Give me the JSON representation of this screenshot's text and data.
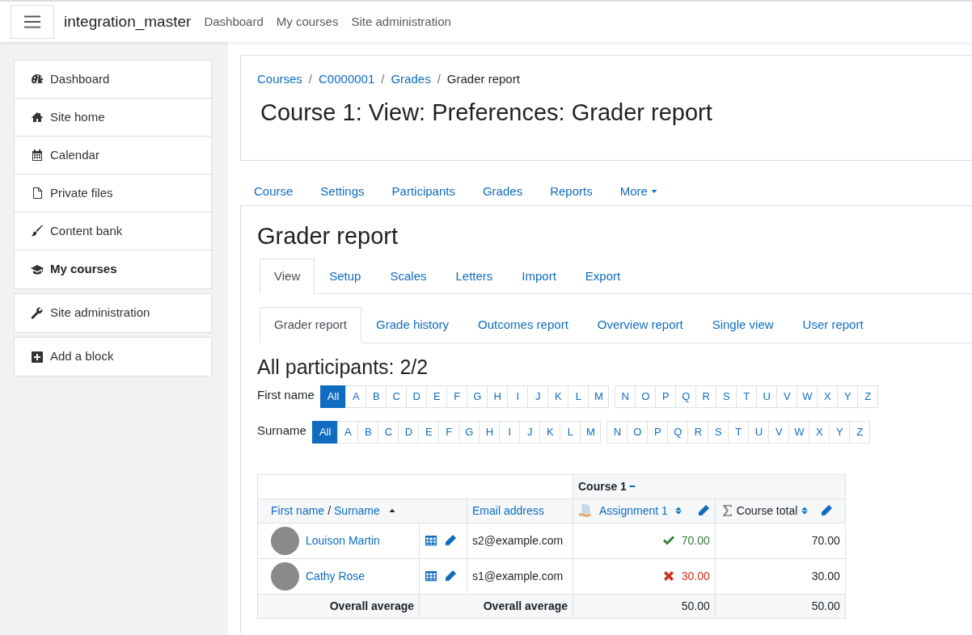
{
  "navbar": {
    "brand": "integration_master",
    "links": [
      "Dashboard",
      "My courses",
      "Site administration"
    ]
  },
  "sidebar": {
    "groups": [
      {
        "items": [
          {
            "label": "Dashboard",
            "kind": "gauge",
            "selected": false
          },
          {
            "label": "Site home",
            "kind": "home",
            "selected": false
          },
          {
            "label": "Calendar",
            "kind": "calendar",
            "selected": false
          },
          {
            "label": "Private files",
            "kind": "file",
            "selected": false
          },
          {
            "label": "Content bank",
            "kind": "brush",
            "selected": false
          },
          {
            "label": "My courses",
            "kind": "cap",
            "selected": true
          }
        ]
      },
      {
        "items": [
          {
            "label": "Site administration",
            "kind": "wrench",
            "selected": false
          }
        ]
      },
      {
        "items": [
          {
            "label": "Add a block",
            "kind": "plus",
            "selected": false
          }
        ]
      }
    ]
  },
  "breadcrumb": [
    {
      "kind": "link",
      "text": "Courses"
    },
    {
      "kind": "separator",
      "text": "/"
    },
    {
      "kind": "link",
      "text": "C0000001"
    },
    {
      "kind": "separator",
      "text": "/"
    },
    {
      "kind": "link",
      "text": "Grades"
    },
    {
      "kind": "separator",
      "text": "/"
    },
    {
      "kind": "current",
      "text": "Grader report"
    }
  ],
  "page_title": "Course 1: View: Preferences: Grader report",
  "course_nav": [
    {
      "label": "Course",
      "dropdown": false
    },
    {
      "label": "Settings",
      "dropdown": false
    },
    {
      "label": "Participants",
      "dropdown": false
    },
    {
      "label": "Grades",
      "dropdown": false
    },
    {
      "label": "Reports",
      "dropdown": false
    },
    {
      "label": "More",
      "dropdown": true
    }
  ],
  "report_title": "Grader report",
  "tabs": [
    {
      "label": "View",
      "selected": true
    },
    {
      "label": "Setup",
      "selected": false
    },
    {
      "label": "Scales",
      "selected": false
    },
    {
      "label": "Letters",
      "selected": false
    },
    {
      "label": "Import",
      "selected": false
    },
    {
      "label": "Export",
      "selected": false
    }
  ],
  "subtabs": [
    {
      "label": "Grader report",
      "selected": true
    },
    {
      "label": "Grade history",
      "selected": false
    },
    {
      "label": "Outcomes report",
      "selected": false
    },
    {
      "label": "Overview report",
      "selected": false
    },
    {
      "label": "Single view",
      "selected": false
    },
    {
      "label": "User report",
      "selected": false
    }
  ],
  "participants_heading": "All participants: 2/2",
  "initials_bars": [
    {
      "label": "First name",
      "all": {
        "text": "All",
        "selected": true
      },
      "groups": [
        [
          {
            "text": "A",
            "selected": false
          },
          {
            "text": "B",
            "selected": false
          },
          {
            "text": "C",
            "selected": false
          },
          {
            "text": "D",
            "selected": false
          },
          {
            "text": "E",
            "selected": false
          },
          {
            "text": "F",
            "selected": false
          },
          {
            "text": "G",
            "selected": false
          },
          {
            "text": "H",
            "selected": false
          },
          {
            "text": "I",
            "selected": false
          },
          {
            "text": "J",
            "selected": false
          },
          {
            "text": "K",
            "selected": false
          },
          {
            "text": "L",
            "selected": false
          },
          {
            "text": "M",
            "selected": false
          }
        ],
        [
          {
            "text": "N",
            "selected": false
          },
          {
            "text": "O",
            "selected": false
          },
          {
            "text": "P",
            "selected": false
          },
          {
            "text": "Q",
            "selected": false
          },
          {
            "text": "R",
            "selected": false
          },
          {
            "text": "S",
            "selected": false
          },
          {
            "text": "T",
            "selected": false
          },
          {
            "text": "U",
            "selected": false
          },
          {
            "text": "V",
            "selected": false
          },
          {
            "text": "W",
            "selected": false
          },
          {
            "text": "X",
            "selected": false
          },
          {
            "text": "Y",
            "selected": false
          },
          {
            "text": "Z",
            "selected": false
          }
        ]
      ]
    },
    {
      "label": "Surname",
      "all": {
        "text": "All",
        "selected": true
      },
      "groups": [
        [
          {
            "text": "A",
            "selected": false
          },
          {
            "text": "B",
            "selected": false
          },
          {
            "text": "C",
            "selected": false
          },
          {
            "text": "D",
            "selected": false
          },
          {
            "text": "E",
            "selected": false
          },
          {
            "text": "F",
            "selected": false
          },
          {
            "text": "G",
            "selected": false
          },
          {
            "text": "H",
            "selected": false
          },
          {
            "text": "I",
            "selected": false
          },
          {
            "text": "J",
            "selected": false
          },
          {
            "text": "K",
            "selected": false
          },
          {
            "text": "L",
            "selected": false
          },
          {
            "text": "M",
            "selected": false
          }
        ],
        [
          {
            "text": "N",
            "selected": false
          },
          {
            "text": "O",
            "selected": false
          },
          {
            "text": "P",
            "selected": false
          },
          {
            "text": "Q",
            "selected": false
          },
          {
            "text": "R",
            "selected": false
          },
          {
            "text": "S",
            "selected": false
          },
          {
            "text": "T",
            "selected": false
          },
          {
            "text": "U",
            "selected": false
          },
          {
            "text": "V",
            "selected": false
          },
          {
            "text": "W",
            "selected": false
          },
          {
            "text": "X",
            "selected": false
          },
          {
            "text": "Y",
            "selected": false
          },
          {
            "text": "Z",
            "selected": false
          }
        ]
      ]
    }
  ],
  "grade_table": {
    "category": "Course 1",
    "columns": {
      "first_name": "First name",
      "name_separator": "/",
      "surname": "Surname",
      "email": "Email address",
      "assignment": "Assignment 1",
      "total": "Course total"
    },
    "rows": [
      {
        "name": "Louison Martin",
        "email": "s2@example.com",
        "grade": "70.00",
        "kind": "pass",
        "total": "70.00"
      },
      {
        "name": "Cathy Rose",
        "email": "s1@example.com",
        "grade": "30.00",
        "kind": "fail",
        "total": "30.00"
      }
    ],
    "average": {
      "label_1": "Overall average",
      "label_2": "Overall average",
      "grade": "50.00",
      "total": "50.00"
    }
  }
}
